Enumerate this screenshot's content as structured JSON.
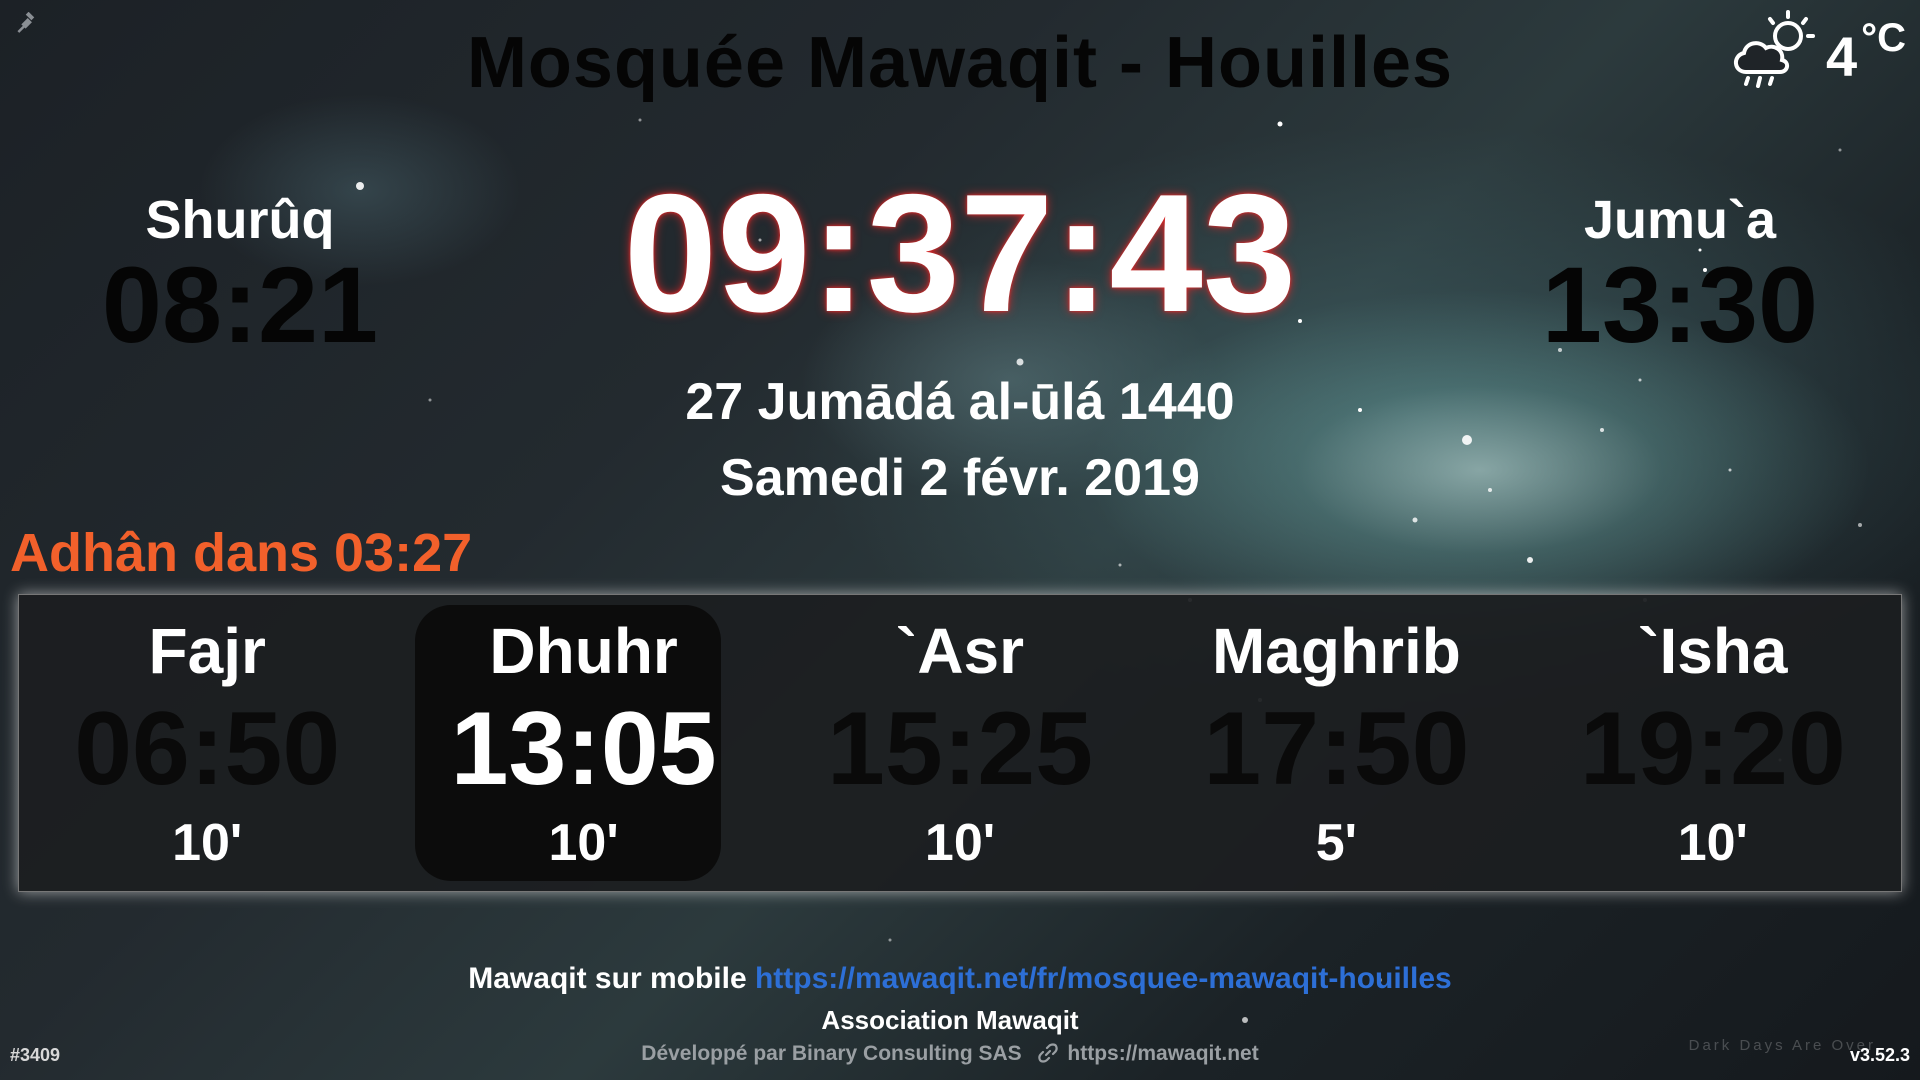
{
  "header": {
    "title": "Mosquée Mawaqit - Houilles",
    "icons": {
      "pin": "pin-icon",
      "weather": "cloud-sun-rain-icon"
    }
  },
  "weather": {
    "temperature": "4",
    "unit": "°C"
  },
  "shuruq": {
    "label": "Shurûq",
    "time": "08:21"
  },
  "jumua": {
    "label": "Jumu`a",
    "time": "13:30"
  },
  "clock": {
    "time": "09:37:43"
  },
  "dates": {
    "hijri": "27 Jumādá al-ūlá 1440",
    "gregorian": "Samedi 2 févr. 2019"
  },
  "countdown": {
    "text": "Adhân dans 03:27",
    "color": "#f2602b"
  },
  "prayers": [
    {
      "name": "Fajr",
      "time": "06:50",
      "iqama": "10'"
    },
    {
      "name": "Dhuhr",
      "time": "13:05",
      "iqama": "10'",
      "active": true
    },
    {
      "name": "`Asr",
      "time": "15:25",
      "iqama": "10'"
    },
    {
      "name": "Maghrib",
      "time": "17:50",
      "iqama": "5'"
    },
    {
      "name": "`Isha",
      "time": "19:20",
      "iqama": "10'"
    }
  ],
  "footer": {
    "mobile_label": "Mawaqit sur mobile",
    "mobile_url": "https://mawaqit.net/fr/mosquee-mawaqit-houilles",
    "association": "Association Mawaqit",
    "developer": "Développé par Binary Consulting SAS",
    "site_url": "https://mawaqit.net",
    "build_id": "#3409",
    "version": "v3.52.3",
    "watermark": "Dark Days Are Over"
  },
  "colors": {
    "accent": "#f2602b",
    "link": "#2d6fd6",
    "clock_glow": "#dc2828",
    "panel_bg": "#1c1e20",
    "active_bg": "#0c0c0c"
  }
}
